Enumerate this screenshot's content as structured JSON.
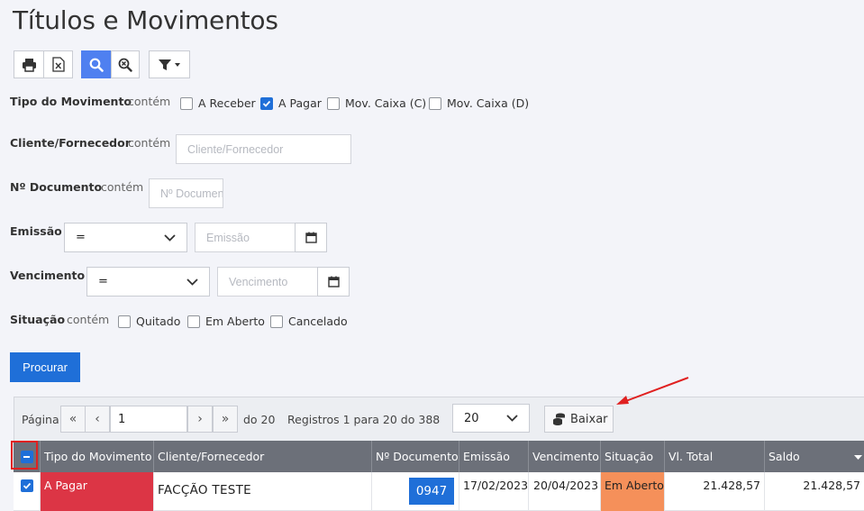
{
  "page": {
    "title": "Títulos e Movimentos"
  },
  "filters": {
    "contains_word": "contém",
    "tipo": {
      "label": "Tipo do Movimento",
      "options": [
        {
          "label": "A Receber",
          "checked": false
        },
        {
          "label": "A Pagar",
          "checked": true
        },
        {
          "label": "Mov. Caixa (C)",
          "checked": false
        },
        {
          "label": "Mov. Caixa (D)",
          "checked": false
        }
      ]
    },
    "cliente": {
      "label": "Cliente/Fornecedor",
      "placeholder": "Cliente/Fornecedor"
    },
    "documento": {
      "label": "Nº Documento",
      "placeholder": "Nº Documento"
    },
    "emissao": {
      "label": "Emissão",
      "operator": "=",
      "placeholder": "Emissão"
    },
    "vencimento": {
      "label": "Vencimento",
      "operator": "=",
      "placeholder": "Vencimento"
    },
    "situacao": {
      "label": "Situação",
      "options": [
        {
          "label": "Quitado",
          "checked": false
        },
        {
          "label": "Em Aberto",
          "checked": false
        },
        {
          "label": "Cancelado",
          "checked": false
        }
      ]
    },
    "search_button": "Procurar"
  },
  "pagination": {
    "page_label": "Página",
    "current_page": "1",
    "of_text": "do 20",
    "records_text": "Registros 1 para 20 do 388",
    "page_size": "20",
    "action_button": "Baixar"
  },
  "table": {
    "columns": [
      "Tipo do Movimento",
      "Cliente/Fornecedor",
      "Nº Documento",
      "Emissão",
      "Vencimento",
      "Situação",
      "Vl. Total",
      "Saldo"
    ],
    "rows": [
      {
        "tipo": "A Pagar",
        "cliente": "FACÇÃO TESTE",
        "documento": "0947",
        "emissao": "17/02/2023",
        "vencimento": "20/04/2023",
        "situacao": "Em Aberto",
        "total": "21.428,57",
        "saldo": "21.428,57",
        "checked": true
      }
    ]
  },
  "colors": {
    "primary": "#1f6fd8",
    "header": "#6c7079",
    "a_pagar": "#dc3545",
    "em_aberto": "#f5905a",
    "annotation": "#e02020"
  }
}
